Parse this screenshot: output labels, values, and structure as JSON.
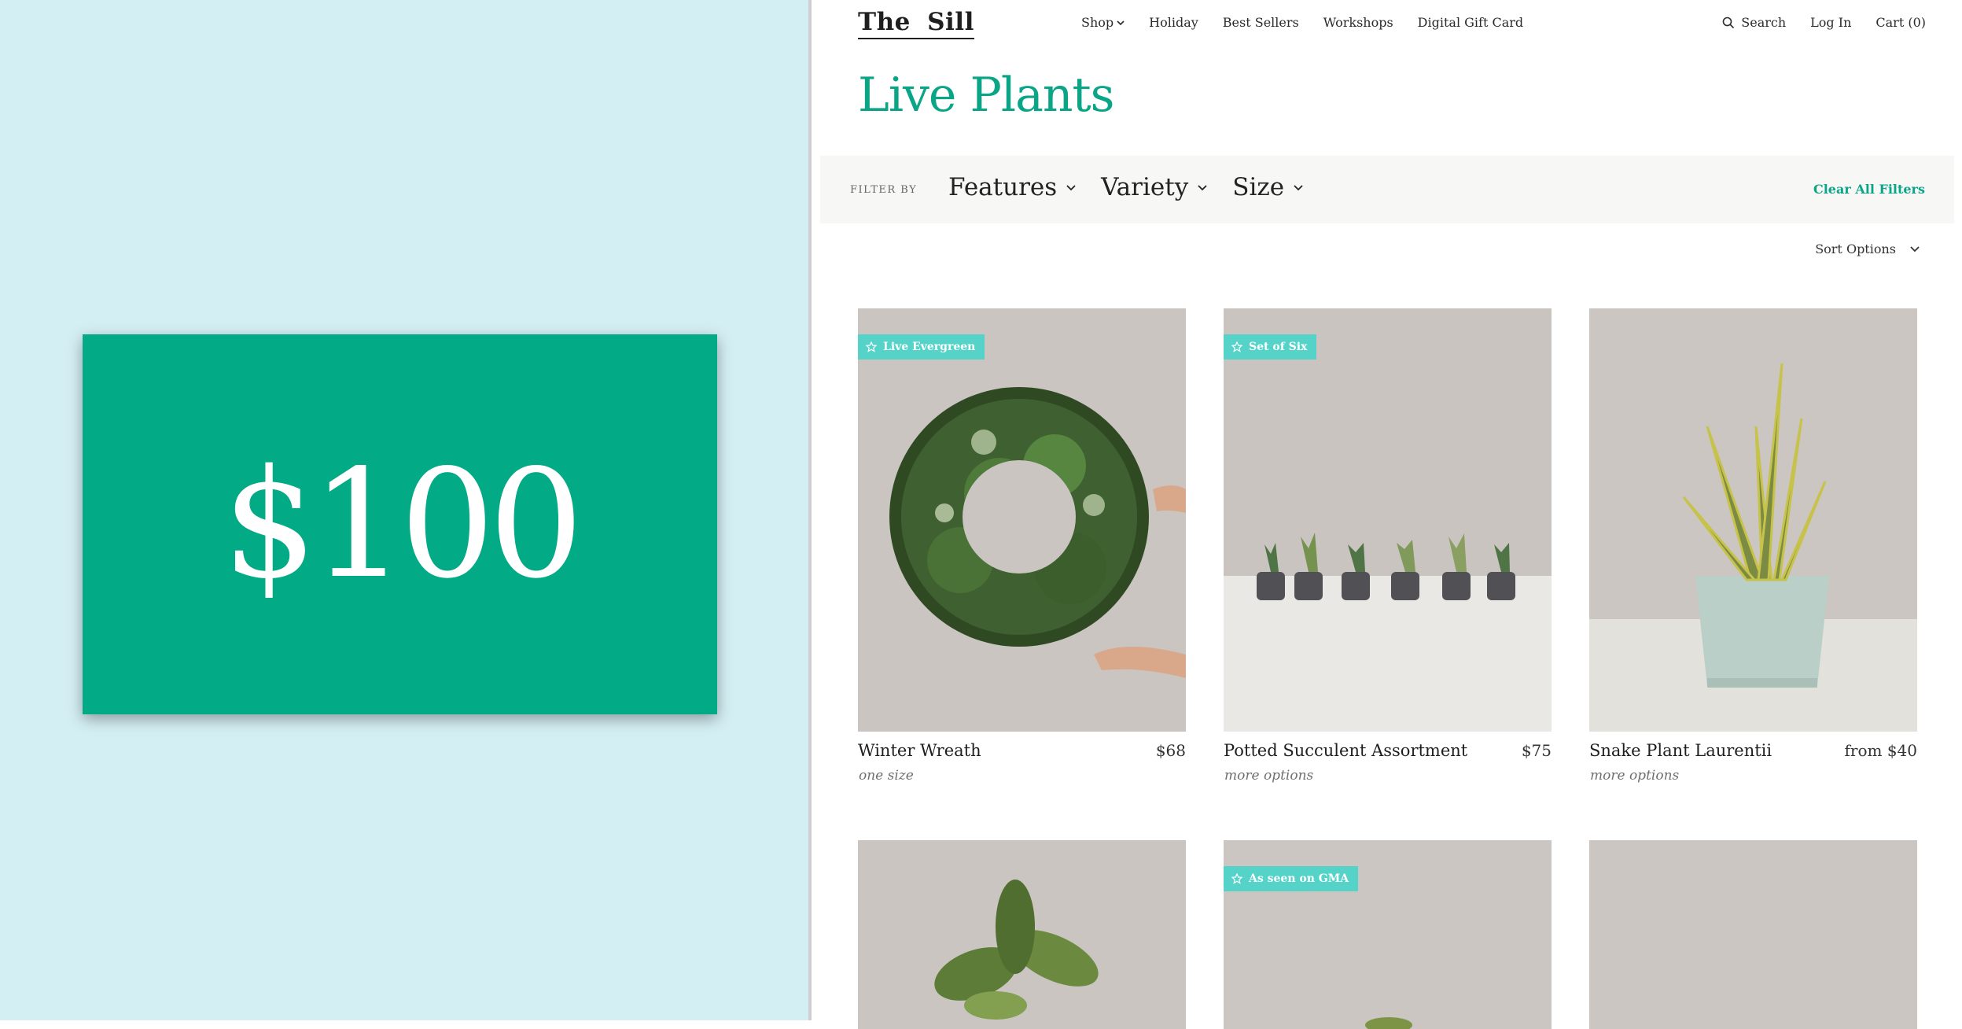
{
  "left_panel": {
    "gift_card_amount": "$100",
    "colors": {
      "background": "#d4eff4",
      "card": "#02aa85"
    }
  },
  "header": {
    "logo": "The Sill",
    "nav": [
      {
        "label": "Shop",
        "has_dropdown": true
      },
      {
        "label": "Holiday"
      },
      {
        "label": "Best Sellers"
      },
      {
        "label": "Workshops"
      },
      {
        "label": "Digital Gift Card"
      }
    ],
    "utility": {
      "search": "Search",
      "login": "Log In",
      "cart": "Cart (0)"
    }
  },
  "page": {
    "title": "Live Plants",
    "accent_color": "#0aa586"
  },
  "filters": {
    "label": "FILTER BY",
    "options": [
      "Features",
      "Variety",
      "Size"
    ],
    "clear": "Clear All Filters"
  },
  "sort": {
    "label": "Sort Options"
  },
  "products": [
    {
      "name": "Winter Wreath",
      "price": "$68",
      "sub": "one size",
      "badge": "Live Evergreen",
      "image": "wreath"
    },
    {
      "name": "Potted Succulent Assortment",
      "price": "$75",
      "sub": "more options",
      "badge": "Set of Six",
      "image": "succulents"
    },
    {
      "name": "Snake Plant Laurentii",
      "price": "from $40",
      "sub": "more options",
      "badge": "",
      "image": "snake-plant"
    }
  ],
  "products_row2": [
    {
      "badge": "",
      "image": "leafy-plant"
    },
    {
      "badge": "As seen on GMA",
      "image": "plant"
    },
    {
      "badge": "",
      "image": "plant"
    }
  ]
}
